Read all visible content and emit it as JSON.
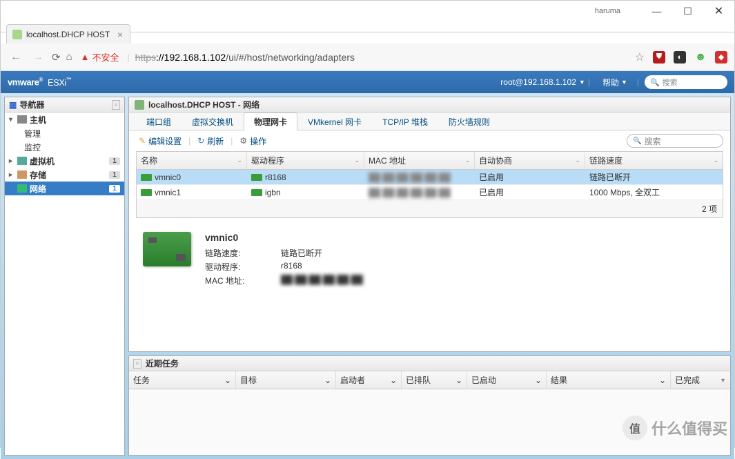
{
  "browser": {
    "window_user": "haruma",
    "tab_title": "localhost.DHCP HOST",
    "insecure_label": "不安全",
    "url_scheme": "https",
    "url_host": "://192.168.1.102",
    "url_path": "/ui/#/host/networking/adapters"
  },
  "topbar": {
    "logo_brand": "vmware",
    "logo_product": "ESXi",
    "user_text": "root@192.168.1.102",
    "help_label": "帮助",
    "search_placeholder": "搜索"
  },
  "navigator": {
    "title": "导航器",
    "host_label": "主机",
    "manage_label": "管理",
    "monitor_label": "监控",
    "vm_label": "虚拟机",
    "vm_count": "1",
    "storage_label": "存储",
    "storage_count": "1",
    "network_label": "网络",
    "network_count": "1"
  },
  "panel": {
    "title": "localhost.DHCP HOST - 网络",
    "tabs": {
      "portgroups": "端口组",
      "vswitches": "虚拟交换机",
      "physical": "物理网卡",
      "vmkernel": "VMkernel 网卡",
      "tcpip": "TCP/IP 堆栈",
      "firewall": "防火墙规则"
    },
    "toolbar": {
      "edit": "编辑设置",
      "refresh": "刷新",
      "actions": "操作",
      "search_placeholder": "搜索"
    },
    "columns": {
      "name": "名称",
      "driver": "驱动程序",
      "mac": "MAC 地址",
      "auto": "自动协商",
      "speed": "链路速度"
    },
    "rows": [
      {
        "name": "vmnic0",
        "driver": "r8168",
        "mac": "██:██:██:██:██:██",
        "auto": "已启用",
        "speed": "链路已断开"
      },
      {
        "name": "vmnic1",
        "driver": "igbn",
        "mac": "██:██:██:██:██:██",
        "auto": "已启用",
        "speed": "1000 Mbps, 全双工"
      }
    ],
    "footer_count": "2 项",
    "detail": {
      "name": "vmnic0",
      "speed_label": "链路速度:",
      "speed_value": "链路已断开",
      "driver_label": "驱动程序:",
      "driver_value": "r8168",
      "mac_label": "MAC 地址:",
      "mac_value": "██:██:██:██:██:██"
    }
  },
  "tasks": {
    "title": "近期任务",
    "columns": {
      "task": "任务",
      "target": "目标",
      "initiator": "启动者",
      "queued": "已排队",
      "started": "已启动",
      "result": "结果",
      "completed": "已完成"
    }
  },
  "watermark": "什么值得买"
}
